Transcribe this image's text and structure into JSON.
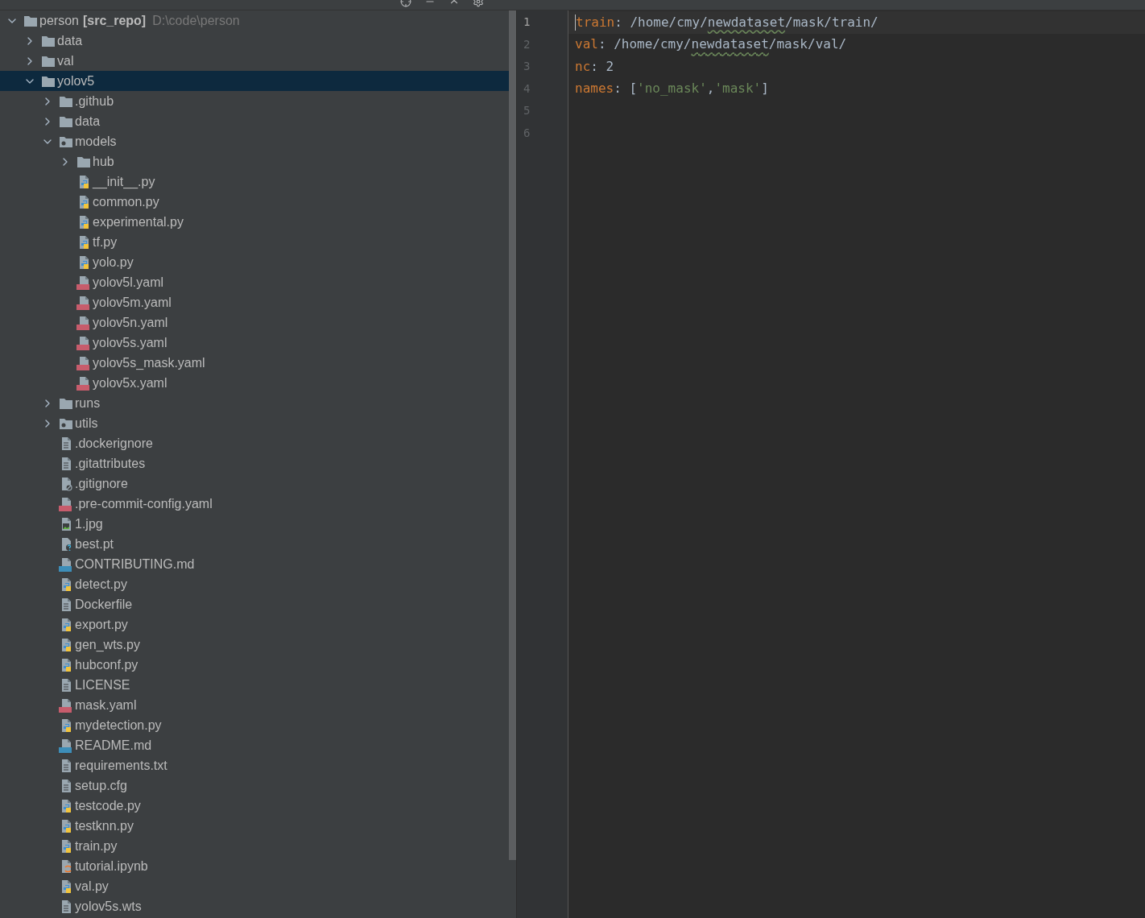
{
  "project_tree": {
    "label": "person",
    "tag": "[src_repo]",
    "path": "D:\\code\\person",
    "kind": "folder",
    "expanded": true,
    "selected": false,
    "children": [
      {
        "label": "data",
        "kind": "folder",
        "expanded": false,
        "selected": false
      },
      {
        "label": "val",
        "kind": "folder",
        "expanded": false,
        "selected": false
      },
      {
        "label": "yolov5",
        "kind": "folder",
        "expanded": true,
        "selected": true,
        "children": [
          {
            "label": ".github",
            "kind": "folder",
            "expanded": false,
            "selected": false
          },
          {
            "label": "data",
            "kind": "folder",
            "expanded": false,
            "selected": false
          },
          {
            "label": "models",
            "kind": "package",
            "expanded": true,
            "selected": false,
            "children": [
              {
                "label": "hub",
                "kind": "folder",
                "expanded": false,
                "selected": false
              },
              {
                "label": "__init__.py",
                "kind": "python",
                "selected": false
              },
              {
                "label": "common.py",
                "kind": "python",
                "selected": false
              },
              {
                "label": "experimental.py",
                "kind": "python",
                "selected": false
              },
              {
                "label": "tf.py",
                "kind": "python",
                "selected": false
              },
              {
                "label": "yolo.py",
                "kind": "python",
                "selected": false
              },
              {
                "label": "yolov5l.yaml",
                "kind": "yaml",
                "selected": false
              },
              {
                "label": "yolov5m.yaml",
                "kind": "yaml",
                "selected": false
              },
              {
                "label": "yolov5n.yaml",
                "kind": "yaml",
                "selected": false
              },
              {
                "label": "yolov5s.yaml",
                "kind": "yaml",
                "selected": false
              },
              {
                "label": "yolov5s_mask.yaml",
                "kind": "yaml",
                "selected": false
              },
              {
                "label": "yolov5x.yaml",
                "kind": "yaml",
                "selected": false
              }
            ]
          },
          {
            "label": "runs",
            "kind": "folder",
            "expanded": false,
            "selected": false
          },
          {
            "label": "utils",
            "kind": "package",
            "expanded": false,
            "selected": false
          },
          {
            "label": ".dockerignore",
            "kind": "text",
            "selected": false
          },
          {
            "label": ".gitattributes",
            "kind": "text",
            "selected": false
          },
          {
            "label": ".gitignore",
            "kind": "ignore",
            "selected": false
          },
          {
            "label": ".pre-commit-config.yaml",
            "kind": "yaml",
            "selected": false
          },
          {
            "label": "1.jpg",
            "kind": "image",
            "selected": false
          },
          {
            "label": "best.pt",
            "kind": "unknown",
            "selected": false
          },
          {
            "label": "CONTRIBUTING.md",
            "kind": "markdown",
            "selected": false
          },
          {
            "label": "detect.py",
            "kind": "python",
            "selected": false
          },
          {
            "label": "Dockerfile",
            "kind": "text",
            "selected": false
          },
          {
            "label": "export.py",
            "kind": "python",
            "selected": false
          },
          {
            "label": "gen_wts.py",
            "kind": "python",
            "selected": false
          },
          {
            "label": "hubconf.py",
            "kind": "python",
            "selected": false
          },
          {
            "label": "LICENSE",
            "kind": "text",
            "selected": false
          },
          {
            "label": "mask.yaml",
            "kind": "yaml",
            "selected": false
          },
          {
            "label": "mydetection.py",
            "kind": "python",
            "selected": false
          },
          {
            "label": "README.md",
            "kind": "markdown",
            "selected": false
          },
          {
            "label": "requirements.txt",
            "kind": "text",
            "selected": false
          },
          {
            "label": "setup.cfg",
            "kind": "text",
            "selected": false
          },
          {
            "label": "testcode.py",
            "kind": "python",
            "selected": false
          },
          {
            "label": "testknn.py",
            "kind": "python",
            "selected": false
          },
          {
            "label": "train.py",
            "kind": "python",
            "selected": false
          },
          {
            "label": "tutorial.ipynb",
            "kind": "notebook",
            "selected": false
          },
          {
            "label": "val.py",
            "kind": "python",
            "selected": false
          },
          {
            "label": "yolov5s.wts",
            "kind": "text",
            "selected": false
          }
        ]
      }
    ]
  },
  "editor": {
    "lines": [
      {
        "number": "1",
        "current": true,
        "tokens": [
          {
            "text": "train",
            "kind": "key"
          },
          {
            "text": ": /home/cmy/",
            "kind": "plain"
          },
          {
            "text": "newdataset",
            "kind": "typo"
          },
          {
            "text": "/mask/train/",
            "kind": "plain"
          }
        ]
      },
      {
        "number": "2",
        "current": false,
        "tokens": [
          {
            "text": "val",
            "kind": "key"
          },
          {
            "text": ": /home/cmy/",
            "kind": "plain"
          },
          {
            "text": "newdataset",
            "kind": "typo"
          },
          {
            "text": "/mask/val/",
            "kind": "plain"
          }
        ]
      },
      {
        "number": "3",
        "current": false,
        "tokens": [
          {
            "text": "nc",
            "kind": "key"
          },
          {
            "text": ": 2",
            "kind": "plain"
          }
        ]
      },
      {
        "number": "4",
        "current": false,
        "tokens": [
          {
            "text": "names",
            "kind": "key"
          },
          {
            "text": ": [",
            "kind": "plain"
          },
          {
            "text": "'no_mask'",
            "kind": "string"
          },
          {
            "text": ",",
            "kind": "plain"
          },
          {
            "text": "'mask'",
            "kind": "string"
          },
          {
            "text": "]",
            "kind": "plain"
          }
        ]
      },
      {
        "number": "5",
        "current": false
      },
      {
        "number": "6",
        "current": false
      }
    ]
  }
}
